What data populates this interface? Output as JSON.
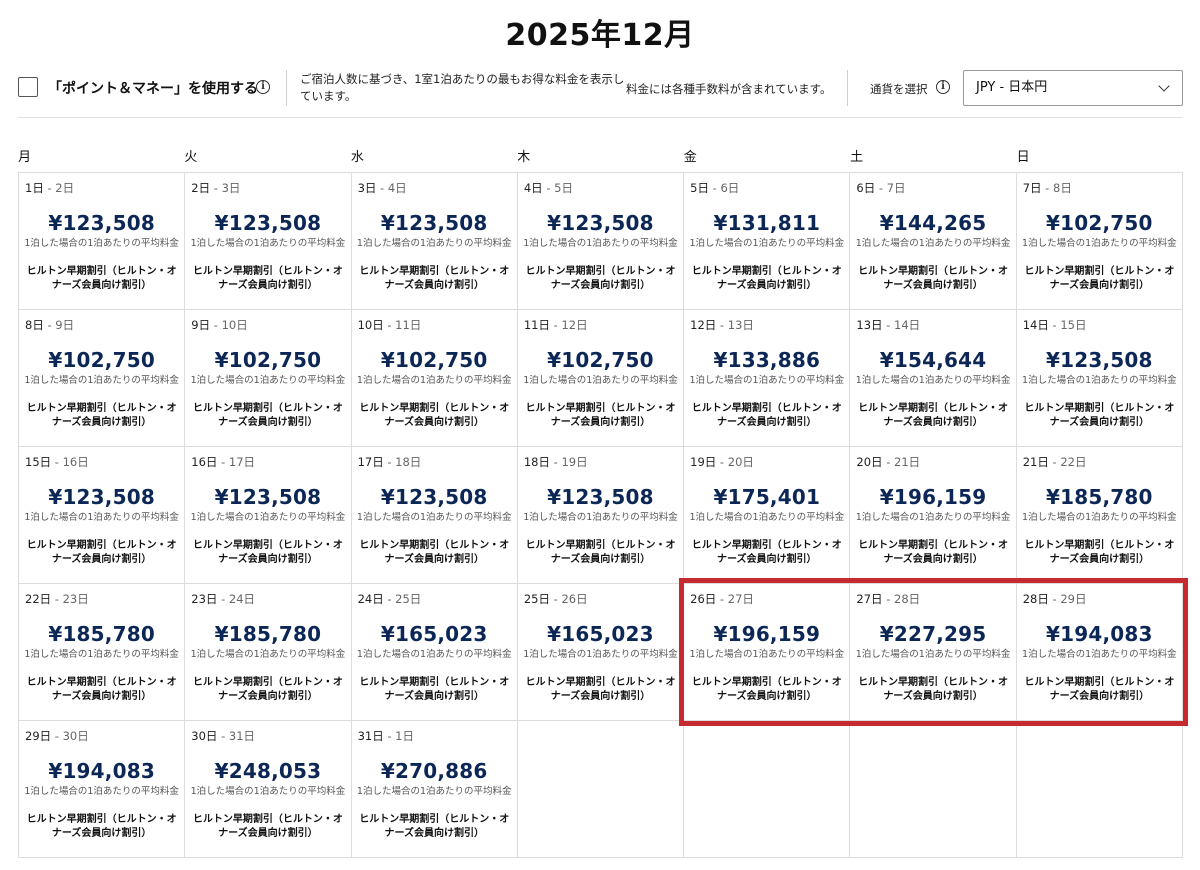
{
  "title": "2025年12月",
  "toolbar": {
    "points_label": "「ポイント＆マネー」を使用する",
    "note_left": "ご宿泊人数に基づき、1室1泊あたりの最もお得な料金を表示しています。",
    "note_right": "料金には各種手数料が含まれています。",
    "currency_label": "通貨を選択",
    "currency_value": "JPY - 日本円"
  },
  "weekdays": [
    "月",
    "火",
    "水",
    "木",
    "金",
    "土",
    "日"
  ],
  "cell_avg_text": "1泊した場合の1泊あたりの平均料金",
  "cell_rate_text": "ヒルトン早期割引（ヒルトン・オナーズ会員向け割引）",
  "days": [
    {
      "checkin": "1日",
      "checkout": "2日",
      "price": "¥123,508"
    },
    {
      "checkin": "2日",
      "checkout": "3日",
      "price": "¥123,508"
    },
    {
      "checkin": "3日",
      "checkout": "4日",
      "price": "¥123,508"
    },
    {
      "checkin": "4日",
      "checkout": "5日",
      "price": "¥123,508"
    },
    {
      "checkin": "5日",
      "checkout": "6日",
      "price": "¥131,811"
    },
    {
      "checkin": "6日",
      "checkout": "7日",
      "price": "¥144,265"
    },
    {
      "checkin": "7日",
      "checkout": "8日",
      "price": "¥102,750"
    },
    {
      "checkin": "8日",
      "checkout": "9日",
      "price": "¥102,750"
    },
    {
      "checkin": "9日",
      "checkout": "10日",
      "price": "¥102,750"
    },
    {
      "checkin": "10日",
      "checkout": "11日",
      "price": "¥102,750"
    },
    {
      "checkin": "11日",
      "checkout": "12日",
      "price": "¥102,750"
    },
    {
      "checkin": "12日",
      "checkout": "13日",
      "price": "¥133,886"
    },
    {
      "checkin": "13日",
      "checkout": "14日",
      "price": "¥154,644"
    },
    {
      "checkin": "14日",
      "checkout": "15日",
      "price": "¥123,508"
    },
    {
      "checkin": "15日",
      "checkout": "16日",
      "price": "¥123,508"
    },
    {
      "checkin": "16日",
      "checkout": "17日",
      "price": "¥123,508"
    },
    {
      "checkin": "17日",
      "checkout": "18日",
      "price": "¥123,508"
    },
    {
      "checkin": "18日",
      "checkout": "19日",
      "price": "¥123,508"
    },
    {
      "checkin": "19日",
      "checkout": "20日",
      "price": "¥175,401"
    },
    {
      "checkin": "20日",
      "checkout": "21日",
      "price": "¥196,159"
    },
    {
      "checkin": "21日",
      "checkout": "22日",
      "price": "¥185,780"
    },
    {
      "checkin": "22日",
      "checkout": "23日",
      "price": "¥185,780"
    },
    {
      "checkin": "23日",
      "checkout": "24日",
      "price": "¥185,780"
    },
    {
      "checkin": "24日",
      "checkout": "25日",
      "price": "¥165,023"
    },
    {
      "checkin": "25日",
      "checkout": "26日",
      "price": "¥165,023"
    },
    {
      "checkin": "26日",
      "checkout": "27日",
      "price": "¥196,159"
    },
    {
      "checkin": "27日",
      "checkout": "28日",
      "price": "¥227,295"
    },
    {
      "checkin": "28日",
      "checkout": "29日",
      "price": "¥194,083"
    },
    {
      "checkin": "29日",
      "checkout": "30日",
      "price": "¥194,083"
    },
    {
      "checkin": "30日",
      "checkout": "31日",
      "price": "¥248,053"
    },
    {
      "checkin": "31日",
      "checkout": "1日",
      "price": "¥270,886"
    }
  ],
  "colors": {
    "price": "#0c2756",
    "highlight": "#c62a2f"
  }
}
